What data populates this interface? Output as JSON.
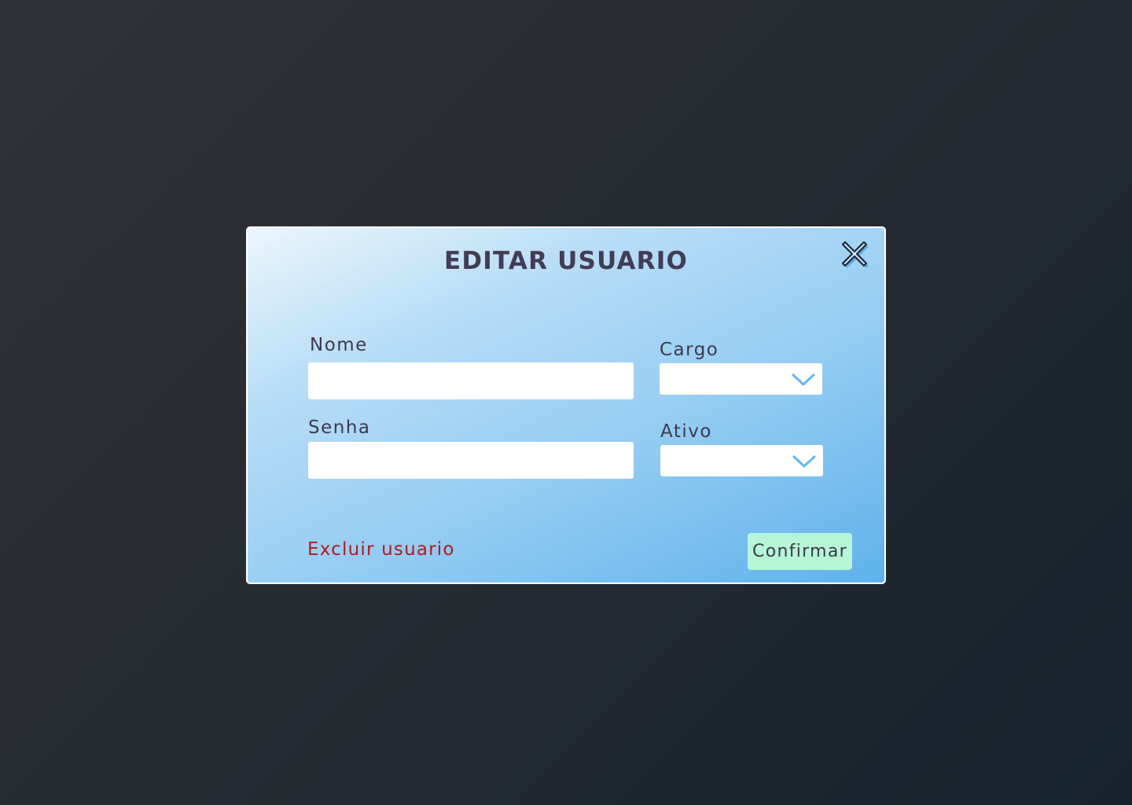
{
  "dialog": {
    "title": "EDITAR USUARIO",
    "close_icon": "close-icon"
  },
  "form": {
    "nome": {
      "label": "Nome",
      "value": "",
      "placeholder": ""
    },
    "senha": {
      "label": "Senha",
      "value": "",
      "placeholder": ""
    },
    "cargo": {
      "label": "Cargo",
      "selected": "",
      "icon": "chevron-down-icon"
    },
    "ativo": {
      "label": "Ativo",
      "selected": "",
      "icon": "chevron-down-icon"
    }
  },
  "actions": {
    "delete_label": "Excluir usuario",
    "confirm_label": "Confirmar"
  },
  "colors": {
    "background": "#252a31",
    "modal_gradient_start": "#eaf6fe",
    "modal_gradient_end": "#5eb2ec",
    "title_text": "#413d54",
    "delete_text": "#b3191c",
    "confirm_bg": "#b6f5d6",
    "chevron": "#6bb8f0"
  }
}
